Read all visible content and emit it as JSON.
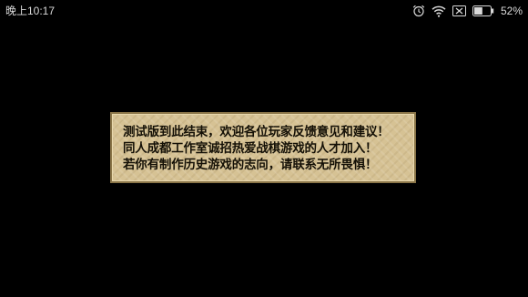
{
  "status_bar": {
    "time": "晚上10:17",
    "icons": [
      "alarm-clock-icon",
      "wifi-icon",
      "no-sim-icon",
      "battery-icon"
    ],
    "battery_percent": "52%"
  },
  "dialog": {
    "lines": [
      "测试版到此结束，欢迎各位玩家反馈意见和建议！",
      "同人成都工作室诚招热爱战棋游戏的人才加入！",
      "若你有制作历史游戏的志向，请联系无所畏惧！"
    ]
  },
  "colors": {
    "background": "#000000",
    "dialog_fill": "#d6c294",
    "dialog_border": "#8a7548",
    "dialog_text": "#141006",
    "status_text": "#d9d9d9"
  },
  "battery_level": 0.52
}
